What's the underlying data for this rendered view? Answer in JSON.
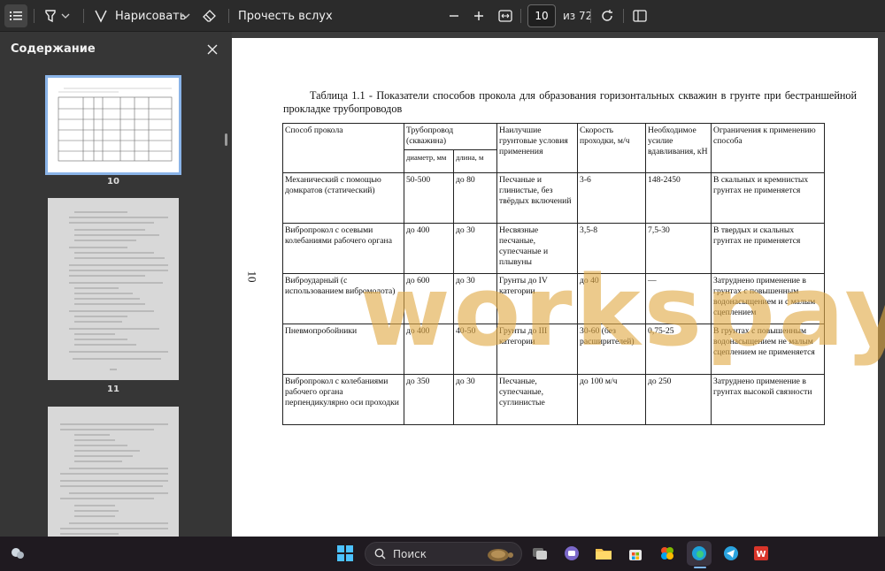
{
  "toolbar": {
    "draw_label": "Нарисовать",
    "read_aloud_label": "Прочесть вслух",
    "current_page": "10",
    "total_pages": "из 72"
  },
  "sidebar": {
    "title": "Содержание",
    "thumbnails": [
      {
        "page": "10"
      },
      {
        "page": "11"
      }
    ]
  },
  "document": {
    "page_number": "10",
    "caption": "Таблица 1.1 - Показатели способов прокола для образования горизонтальных скважин в грунте при бестраншейной прокладке трубопроводов",
    "watermark": "workspay.ru",
    "table": {
      "headers": {
        "method": "Способ прокола",
        "pipe": "Трубопровод (скважина)",
        "diameter": "диаметр, мм",
        "length": "длина, м",
        "soil": "Наилучшие грунтовые условия применения",
        "speed": "Скорость проходки, м/ч",
        "force": "Необходимое усилие вдавливания, кН",
        "limits": "Ограничения к применению способа"
      },
      "rows": [
        {
          "method": "Механический с помощью домкратов (статический)",
          "diameter": "50-500",
          "length": "до 80",
          "soil": "Песчаные и глинистые, без твёрдых включений",
          "speed": "3-6",
          "force": "148-2450",
          "limits": "В скальных и кремнистых грунтах не применяется"
        },
        {
          "method": "Вибропрокол с осевыми колебаниями рабочего органа",
          "diameter": "до 400",
          "length": "до 30",
          "soil": "Несвязные песчаные, супесчаные и плывуны",
          "speed": "3,5-8",
          "force": "7,5-30",
          "limits": "В твердых и скальных грунтах не применяется"
        },
        {
          "method": "Виброударный (с использованием вибромолота)",
          "diameter": "до 600",
          "length": "до 30",
          "soil": "Грунты до IV категории",
          "speed": "до 40",
          "force": "—",
          "limits": "Затруднено применение в грунтах с повышенным водонасыщением и с малым сцеплением"
        },
        {
          "method": "Пневмопробойники",
          "diameter": "до 400",
          "length": "40-50",
          "soil": "Грунты до III категории",
          "speed": "30-60 (без расширителей)",
          "force": "0,75-25",
          "limits": "В грунтах с повышенным водонасыщением не малым сцеплением не применяется"
        },
        {
          "method": "Вибропрокол с колебаниями рабочего органа перпендикулярно оси проходки",
          "diameter": "до 350",
          "length": "до 30",
          "soil": "Песчаные, супесчаные, суглинистые",
          "speed": "до 100 м/ч",
          "force": "до 250",
          "limits": "Затруднено применение в грунтах высокой связности"
        }
      ]
    }
  },
  "taskbar": {
    "search_label": "Поиск"
  },
  "colors": {
    "toolbar_bg": "#2b2b2b",
    "sidebar_bg": "#363636",
    "selection": "#8ab4e8",
    "watermark": "#e1aa46",
    "taskbar_bg": "#1f1a20"
  }
}
